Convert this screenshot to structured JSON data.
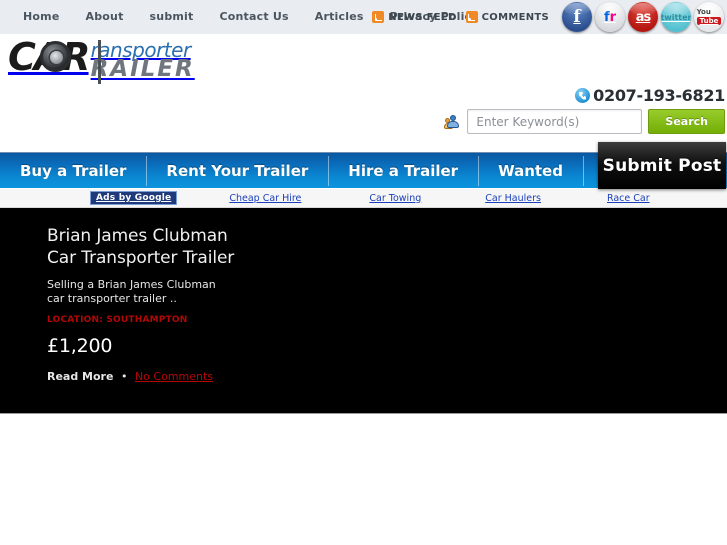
{
  "topbar": {
    "nav": [
      {
        "label": "Home"
      },
      {
        "label": "About"
      },
      {
        "label": "submit"
      },
      {
        "label": "Contact Us"
      },
      {
        "label": "Articles"
      },
      {
        "label": "Privacy Policy"
      }
    ],
    "news_feed_label": "NEWS FEED",
    "comments_label": "COMMENTS",
    "socials": [
      {
        "name": "facebook",
        "glyph": "f"
      },
      {
        "name": "flickr",
        "glyph": "fr"
      },
      {
        "name": "lastfm",
        "glyph": "as"
      },
      {
        "name": "twitter",
        "glyph": "twitter"
      },
      {
        "name": "youtube",
        "glyph_top": "You",
        "glyph_bottom": "Tube"
      }
    ],
    "background_color": "#e9ecf0"
  },
  "logo": {
    "car": "CAR",
    "transporter": "ransporter",
    "trailer": "RAILER",
    "transporter_color": "#2a6fb0",
    "trailer_color": "#6f767d"
  },
  "contact": {
    "phone": "0207-193-6821",
    "phone_icon": "phone-icon"
  },
  "search": {
    "placeholder": "Enter Keyword(s)",
    "value": "",
    "button_label": "Search",
    "button_color": "#86bd1a",
    "user_icon": "users-icon"
  },
  "mainnav": {
    "items": [
      {
        "label": "Buy a Trailer"
      },
      {
        "label": "Rent Your Trailer"
      },
      {
        "label": "Hire a Trailer"
      },
      {
        "label": "Wanted"
      }
    ],
    "accent_color": "#0c8fdb",
    "submit_post_label": "Submit Post"
  },
  "ads": {
    "badge": "Ads by Google",
    "badge_color": "#1f3a7a",
    "links": [
      {
        "label": "Cheap Car Hire"
      },
      {
        "label": "Car Towing"
      },
      {
        "label": "Car Haulers"
      },
      {
        "label": "Race Car"
      }
    ],
    "link_color": "#1a3fbb"
  },
  "listing": {
    "title_line1": "Brian James Clubman",
    "title_line2": "Car Transporter Trailer",
    "description_line1": "Selling a Brian James Clubman",
    "description_line2": "car transporter trailer ..",
    "location": "LOCATION: SOUTHAMPTON",
    "location_color": "#b30707",
    "price": "£1,200",
    "read_more": "Read More",
    "separator": "•",
    "comments": "No Comments",
    "comments_color": "#b30707",
    "background_color": "#000000"
  }
}
